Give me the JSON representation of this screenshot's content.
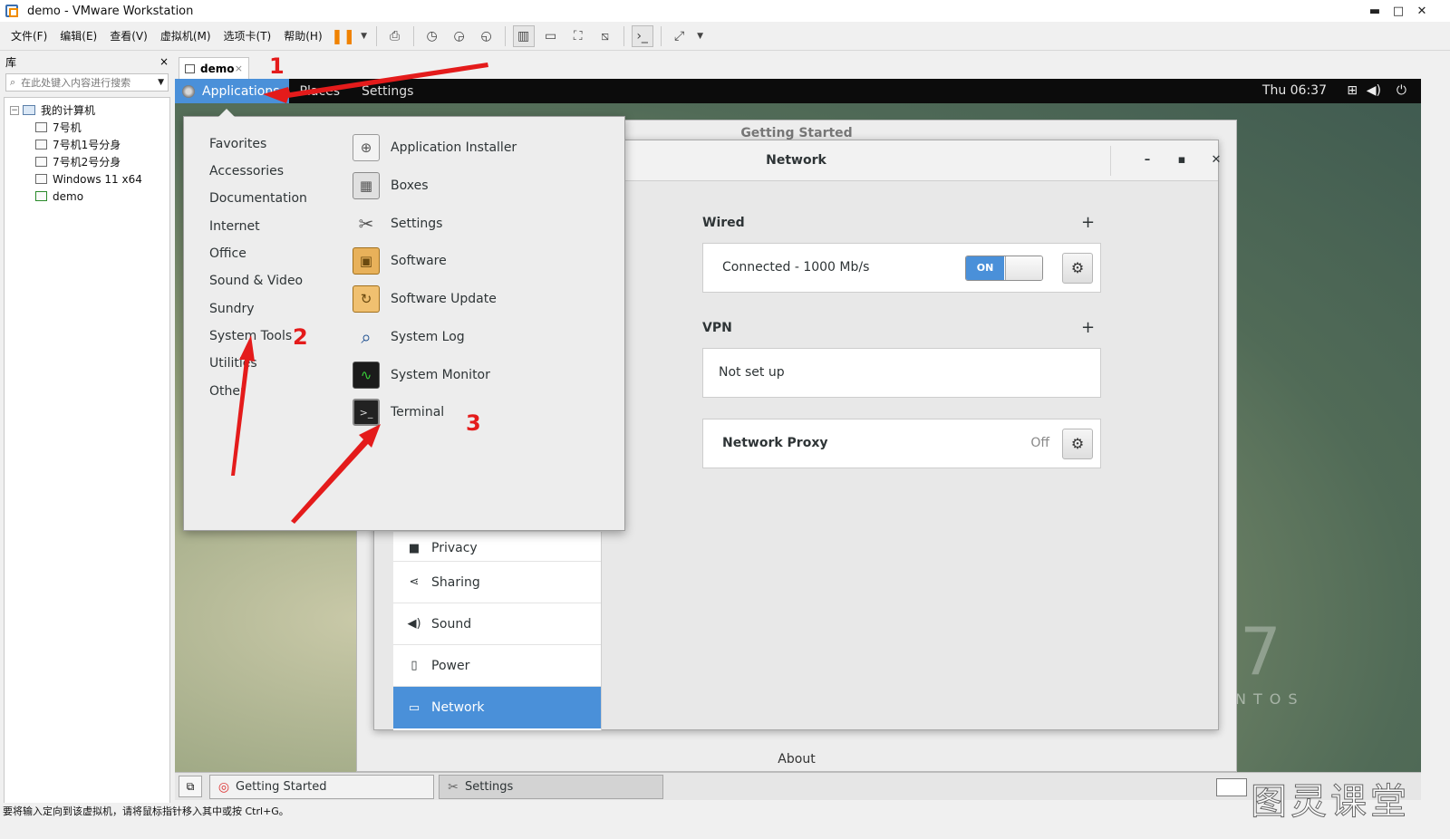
{
  "window": {
    "title": "demo - VMware Workstation",
    "minimize": "▬",
    "maximize": "□",
    "close": "✕"
  },
  "menubar": [
    "文件(F)",
    "编辑(E)",
    "查看(V)",
    "虚拟机(M)",
    "选项卡(T)",
    "帮助(H)"
  ],
  "library": {
    "title": "库",
    "close": "×",
    "search_placeholder": "在此处键入内容进行搜索",
    "root": "我的计算机",
    "items": [
      "7号机",
      "7号机1号分身",
      "7号机2号分身",
      "Windows 11 x64",
      "demo"
    ]
  },
  "vm_tab": {
    "label": "demo",
    "close": "×"
  },
  "gnome_bar": {
    "applications": "Applications",
    "places": "Places",
    "settings": "Settings",
    "clock": "Thu 06:37"
  },
  "app_menu": {
    "categories": [
      "Favorites",
      "Accessories",
      "Documentation",
      "Internet",
      "Office",
      "Sound & Video",
      "Sundry",
      "System Tools",
      "Utilities",
      "Other"
    ],
    "apps": [
      {
        "label": "Application Installer",
        "icon": "installer-icon"
      },
      {
        "label": "Boxes",
        "icon": "boxes-icon"
      },
      {
        "label": "Settings",
        "icon": "settings-tools-icon"
      },
      {
        "label": "Software",
        "icon": "software-icon"
      },
      {
        "label": "Software Update",
        "icon": "software-update-icon"
      },
      {
        "label": "System Log",
        "icon": "system-log-icon"
      },
      {
        "label": "System Monitor",
        "icon": "system-monitor-icon"
      },
      {
        "label": "Terminal",
        "icon": "terminal-icon"
      }
    ]
  },
  "getting_started": {
    "title": "Getting Started",
    "about": "About"
  },
  "network": {
    "title": "Network",
    "wired": {
      "heading": "Wired",
      "status": "Connected - 1000 Mb/s",
      "toggle": "ON"
    },
    "vpn": {
      "heading": "VPN",
      "status": "Not set up"
    },
    "proxy": {
      "label": "Network Proxy",
      "state": "Off"
    }
  },
  "settings_sidebar": [
    {
      "label": "Privacy",
      "icon": "privacy-icon"
    },
    {
      "label": "Sharing",
      "icon": "sharing-icon"
    },
    {
      "label": "Sound",
      "icon": "sound-icon"
    },
    {
      "label": "Power",
      "icon": "power-icon"
    },
    {
      "label": "Network",
      "icon": "network-icon",
      "active": true
    }
  ],
  "taskbar": {
    "getting_started": "Getting Started",
    "settings": "Settings"
  },
  "statusbar": "要将输入定向到该虚拟机，请将鼠标指针移入其中或按 Ctrl+G。",
  "desktop_watermark": "NTOS",
  "brand_watermark": "图灵课堂",
  "annotations": [
    "1",
    "2",
    "3"
  ],
  "colors": {
    "accent": "#4a90d9",
    "annotation": "#e41b1b",
    "pause": "#f08200"
  }
}
